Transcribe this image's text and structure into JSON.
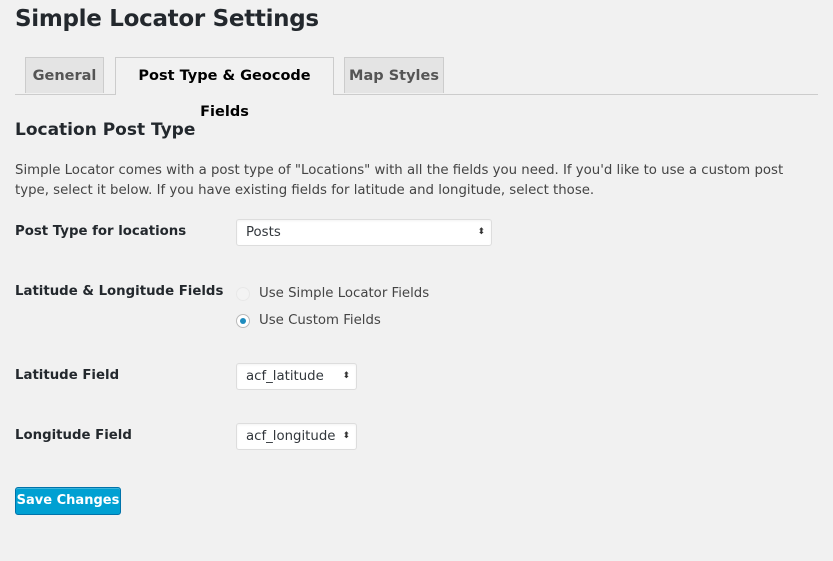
{
  "page_title": "Simple Locator Settings",
  "tabs": [
    {
      "label": "General",
      "active": false
    },
    {
      "label": "Post Type & Geocode Fields",
      "active": true
    },
    {
      "label": "Map Styles",
      "active": false
    }
  ],
  "section": {
    "heading": "Location Post Type",
    "description": "Simple Locator comes with a post type of \"Locations\" with all the fields you need. If you'd like to use a custom post type, select it below. If you have existing fields for latitude and longitude, select those."
  },
  "fields": {
    "post_type": {
      "label": "Post Type for locations",
      "value": "Posts"
    },
    "latlng": {
      "label": "Latitude & Longitude Fields",
      "options": [
        {
          "label": "Use Simple Locator Fields",
          "checked": false,
          "disabled": true
        },
        {
          "label": "Use Custom Fields",
          "checked": true,
          "disabled": false
        }
      ]
    },
    "latitude": {
      "label": "Latitude Field",
      "value": "acf_latitude"
    },
    "longitude": {
      "label": "Longitude Field",
      "value": "acf_longitude"
    }
  },
  "save_label": "Save Changes",
  "colors": {
    "primary": "#00a0d2",
    "background": "#f1f1f1"
  }
}
